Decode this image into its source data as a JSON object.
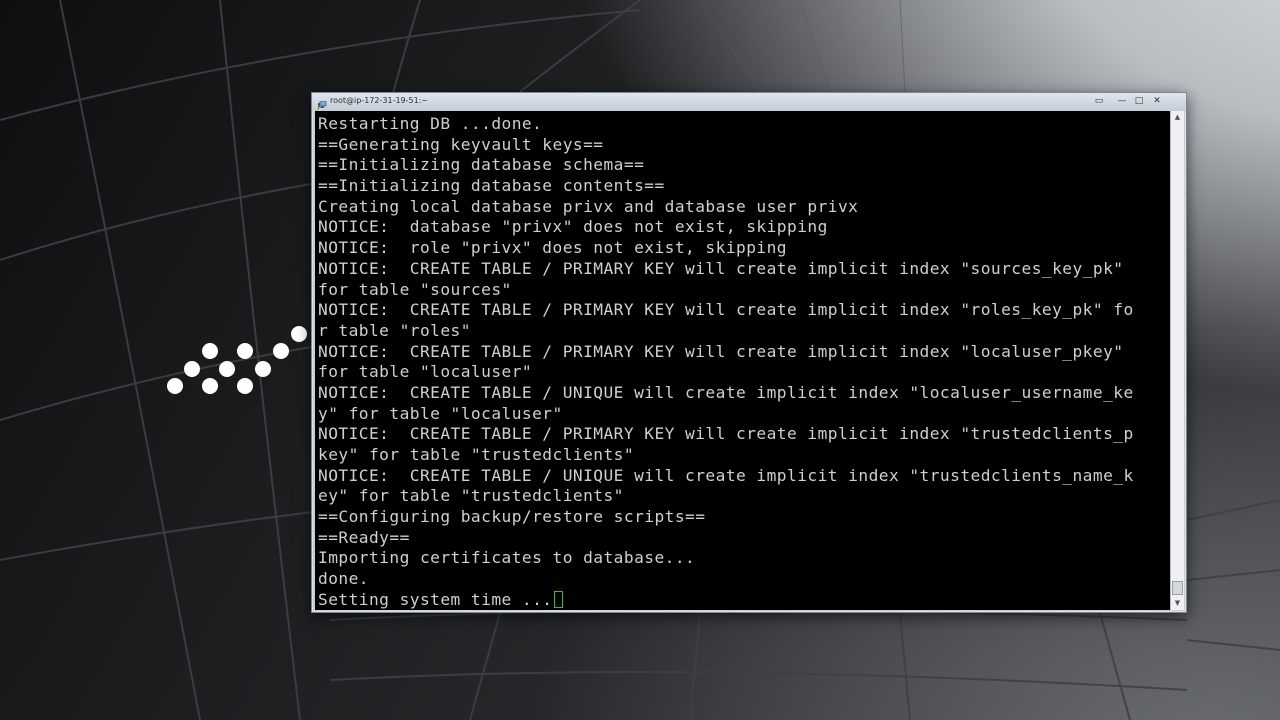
{
  "window": {
    "title": "root@ip-172-31-19-51:~",
    "icon": "putty-icon",
    "buttons": {
      "extra": "▭",
      "minimize": "—",
      "maximize": "□",
      "close": "✕"
    }
  },
  "terminal": {
    "lines": [
      "Restarting DB ...done.",
      "==Generating keyvault keys==",
      "==Initializing database schema==",
      "==Initializing database contents==",
      "Creating local database privx and database user privx",
      "NOTICE:  database \"privx\" does not exist, skipping",
      "NOTICE:  role \"privx\" does not exist, skipping",
      "NOTICE:  CREATE TABLE / PRIMARY KEY will create implicit index \"sources_key_pk\"",
      "for table \"sources\"",
      "NOTICE:  CREATE TABLE / PRIMARY KEY will create implicit index \"roles_key_pk\" fo",
      "r table \"roles\"",
      "NOTICE:  CREATE TABLE / PRIMARY KEY will create implicit index \"localuser_pkey\"",
      "for table \"localuser\"",
      "NOTICE:  CREATE TABLE / UNIQUE will create implicit index \"localuser_username_ke",
      "y\" for table \"localuser\"",
      "NOTICE:  CREATE TABLE / PRIMARY KEY will create implicit index \"trustedclients_p",
      "key\" for table \"trustedclients\"",
      "NOTICE:  CREATE TABLE / UNIQUE will create implicit index \"trustedclients_name_k",
      "ey\" for table \"trustedclients\"",
      "==Configuring backup/restore scripts==",
      "==Ready==",
      "Importing certificates to database...",
      "done.",
      "Setting system time ..."
    ],
    "cursor_color": "#2ec52e",
    "text_color": "#cfcfcf",
    "background": "#000000"
  },
  "scrollbar": {
    "up_arrow": "▲",
    "down_arrow": "▼"
  }
}
